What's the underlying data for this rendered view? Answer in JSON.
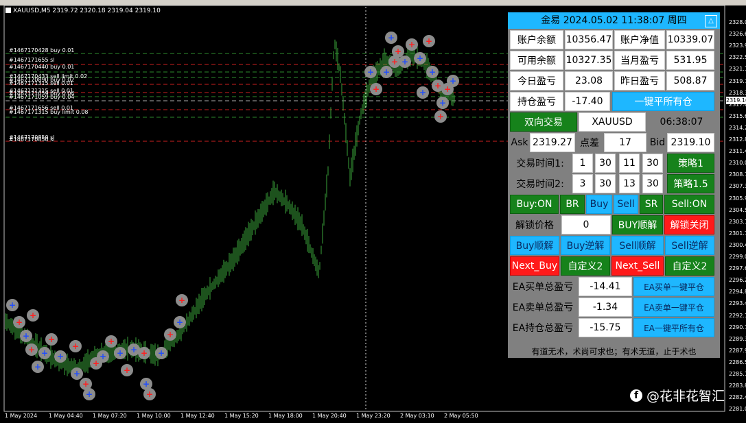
{
  "chart": {
    "symbol_info": "XAUUSD,M5  2319.72 2320.18 2319.04 2319.10",
    "order_labels": [
      "#1467170428 buy 0.01",
      "#1467171655 sl",
      "#1467170440 buy 0.01",
      "#1467170433 sell limit 0.02",
      "#1467170890 buy 0.02",
      "#1467171315 sell 0.01",
      "#1467171059 buy 0.04",
      "#1467171656 sell 0.01",
      "#1467171315 buy limit 0.08",
      "#1467170850 sl"
    ],
    "price_labels": [
      "2328.00",
      "2326.60",
      "2323.90",
      "2322.50",
      "2321.10",
      "2319.75",
      "2318.35",
      "2317.00",
      "2315.60",
      "2314.20",
      "2312.85",
      "2311.45",
      "2310.05",
      "2308.70",
      "2307.30",
      "2305.90",
      "2304.55",
      "2303.15",
      "2301.75",
      "2300.40",
      "2299.00",
      "2297.60",
      "2296.25",
      "2294.85",
      "2293.45",
      "2292.10",
      "2290.70",
      "2289.30",
      "2287.95",
      "2286.55",
      "2285.15",
      "2283.80",
      "2282.40",
      "2281.00"
    ],
    "current_price": "2319.10",
    "time_labels": [
      "1 May 2024",
      "1 May 04:40",
      "1 May 07:20",
      "1 May 10:00",
      "1 May 12:40",
      "1 May 15:20",
      "1 May 18:00",
      "1 May 20:40",
      "1 May 23:20",
      "2 May 03:10",
      "2 May 05:50"
    ],
    "colors": {
      "candle": "#3aa33a",
      "buy_line": "#2e8b2e",
      "sell_line": "#cc2020",
      "buy_marker": "#1e4cff",
      "sell_marker": "#ff2020"
    }
  },
  "panel": {
    "title": "金易 2024.05.02 11:38:07 周四",
    "minimize_icon": "triangle-up-icon",
    "account": {
      "balance_label": "账户余额",
      "balance": "10356.47",
      "equity_label": "账户净值",
      "equity": "10339.07",
      "free_label": "可用余额",
      "free": "10327.35",
      "month_label": "当月盈亏",
      "month": "531.95",
      "today_label": "今日盈亏",
      "today": "23.08",
      "yesterday_label": "昨日盈亏",
      "yesterday": "508.87",
      "position_label": "持仓盈亏",
      "position": "-17.40",
      "close_all_label": "一键平所有仓"
    },
    "trade": {
      "mode_label": "双向交易",
      "symbol": "XAUUSD",
      "time": "06:38:07",
      "ask_label": "Ask",
      "ask": "2319.27",
      "spread_label": "点差",
      "spread": "17",
      "bid_label": "Bid",
      "bid": "2319.10"
    },
    "sessions": [
      {
        "label": "交易时间1:",
        "v1": "1",
        "v2": "30",
        "v3": "11",
        "v4": "30",
        "strategy": "策略1"
      },
      {
        "label": "交易时间2:",
        "v1": "3",
        "v2": "30",
        "v3": "13",
        "v4": "30",
        "strategy": "策略1.5"
      }
    ],
    "buttons_row1": [
      "Buy:ON",
      "BR",
      "Buy",
      "Sell",
      "SR",
      "Sell:ON"
    ],
    "unlock": {
      "label": "解锁价格",
      "value": "0",
      "buy_btn": "BUY顺解",
      "close_btn": "解锁关闭"
    },
    "buttons_row2": [
      "Buy顺解",
      "Buy逆解",
      "Sell顺解",
      "Sell逆解"
    ],
    "buttons_row3": [
      "Next_Buy",
      "自定义2",
      "Next_Sell",
      "自定义2"
    ],
    "ea": [
      {
        "label": "EA买单总盈亏",
        "value": "-14.41",
        "btn": "EA买单一键平仓"
      },
      {
        "label": "EA卖单总盈亏",
        "value": "-1.34",
        "btn": "EA卖单一键平仓"
      },
      {
        "label": "EA持仓总盈亏",
        "value": "-15.75",
        "btn": "EA一键平所有仓"
      }
    ],
    "footer": "有道无术，术尚可求也；有术无道，止于术也"
  },
  "watermark": {
    "icon": "facebook-icon",
    "text": "@花非花智汇"
  }
}
